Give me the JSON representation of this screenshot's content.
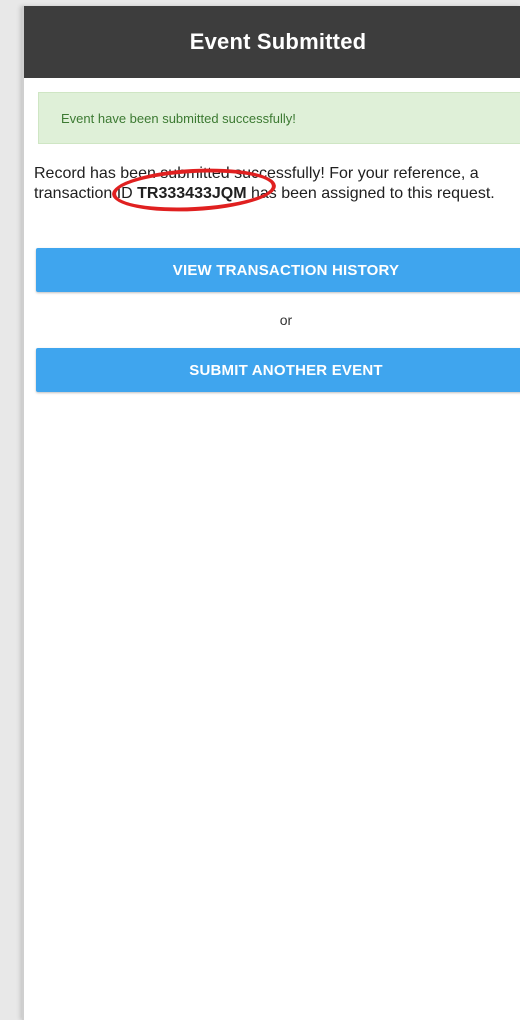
{
  "header": {
    "title": "Event Submitted"
  },
  "alert": {
    "text": "Event have been submitted successfully!"
  },
  "message": {
    "prefix": "Record has been submitted successfully! For your reference, a transaction ID ",
    "transaction_id": "TR333433JQM",
    "suffix": " has been assigned to this request."
  },
  "actions": {
    "view_history_label": "VIEW TRANSACTION HISTORY",
    "separator": "or",
    "submit_another_label": "SUBMIT ANOTHER EVENT"
  },
  "colors": {
    "header_bg": "#3d3d3d",
    "alert_bg": "#dff0d8",
    "alert_text": "#3c7a32",
    "button_bg": "#3fa5ee",
    "highlight_circle": "#e02020"
  }
}
